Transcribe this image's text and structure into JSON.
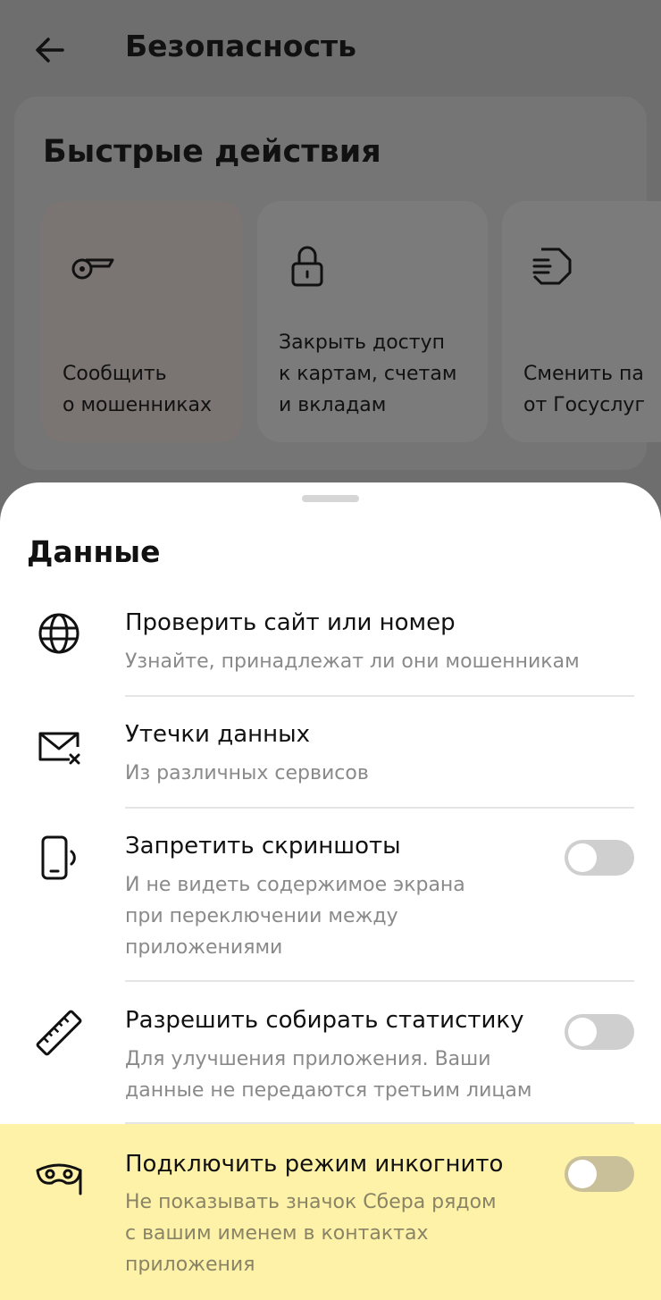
{
  "header": {
    "title": "Безопасность",
    "back_icon": "arrow-left-icon"
  },
  "quick_actions": {
    "title": "Быстрые действия",
    "cards": [
      {
        "icon": "whistle-icon",
        "line1": "Сообщить",
        "line2": "о мошенниках",
        "line3": ""
      },
      {
        "icon": "lock-icon",
        "line1": "Закрыть доступ",
        "line2": "к картам, счетам",
        "line3": "и вкладам"
      },
      {
        "icon": "gosuslugi-icon",
        "line1": "Сменить па",
        "line2": "от Госуслуг",
        "line3": ""
      }
    ]
  },
  "sheet": {
    "title": "Данные",
    "items": [
      {
        "icon": "globe-icon",
        "title": "Проверить сайт или номер",
        "sub1": "Узнайте, принадлежат ли они мошенникам"
      },
      {
        "icon": "mail-leak-icon",
        "title": "Утечки данных",
        "sub1": "Из различных сервисов"
      },
      {
        "icon": "phone-screenshot-icon",
        "title": "Запретить скриншоты",
        "sub1": "И не видеть содержимое экрана",
        "sub2": "при переключении между",
        "sub3": "приложениями",
        "toggle_on": false
      },
      {
        "icon": "ruler-icon",
        "title": "Разрешить собирать статистику",
        "sub1": "Для улучшения приложения. Ваши",
        "sub2": "данные не передаются третьим лицам",
        "toggle_on": false
      },
      {
        "icon": "incognito-mask-icon",
        "title": "Подключить режим инкогнито",
        "sub1": "Не показывать значок Сбера рядом",
        "sub2": "с вашим именем в контактах",
        "sub3": "приложения",
        "toggle_on": false
      }
    ]
  },
  "colors": {
    "highlight": "#fdf2a8",
    "overlay": "#6e6e6e",
    "sheet": "#ffffff"
  }
}
